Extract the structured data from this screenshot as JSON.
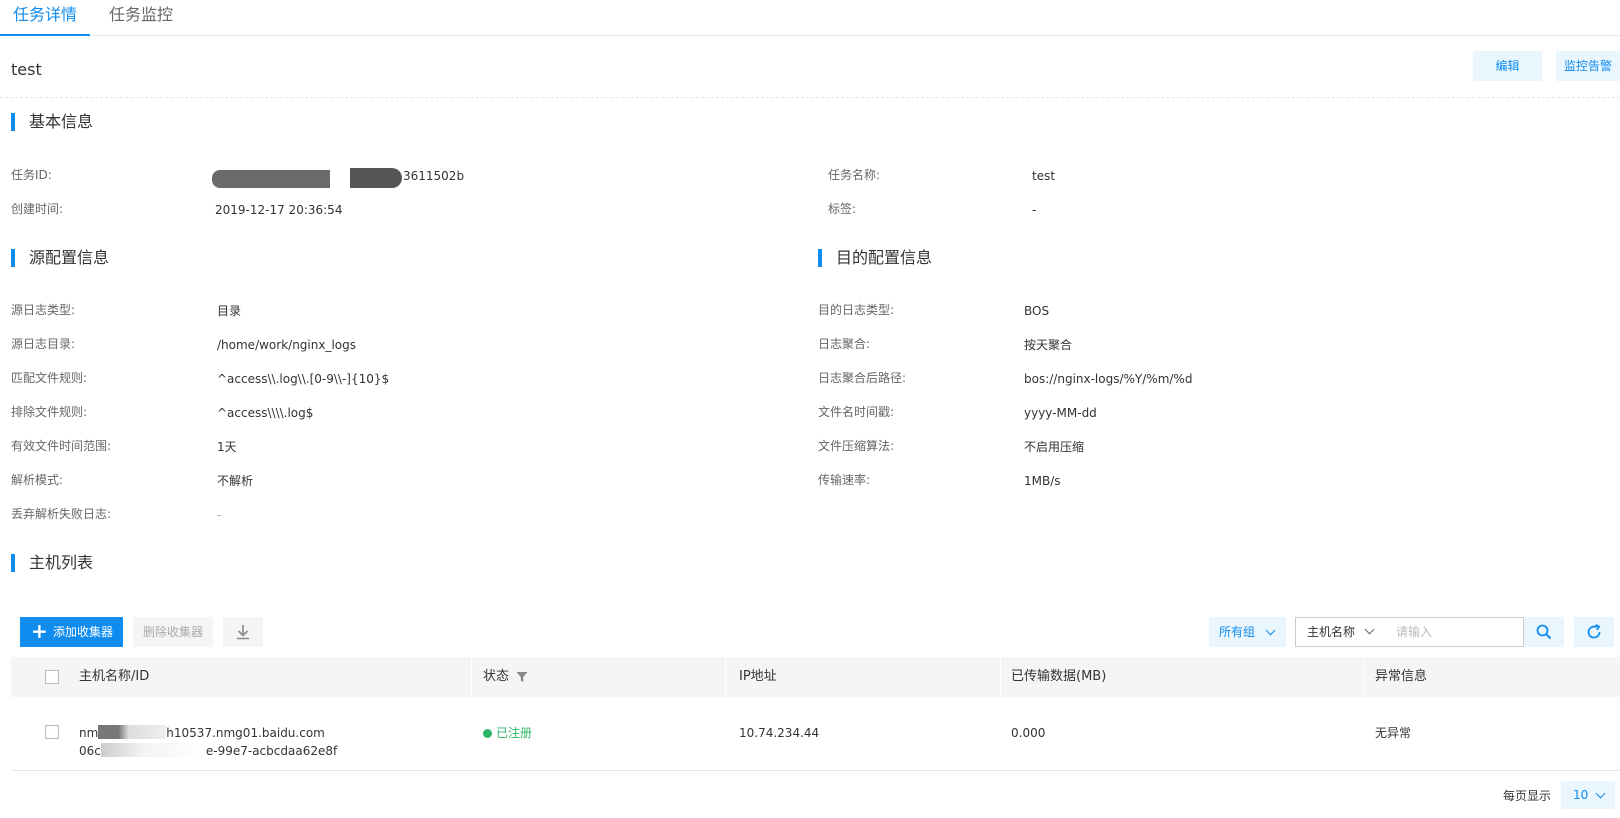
{
  "tabs": [
    {
      "label": "任务详情",
      "active": true
    },
    {
      "label": "任务监控",
      "active": false
    }
  ],
  "header": {
    "title": "test",
    "edit_label": "编辑",
    "alarm_label": "监控告警"
  },
  "basic": {
    "section_title": "基本信息",
    "task_id_label": "任务ID:",
    "task_id_value": "3611502b",
    "task_name_label": "任务名称:",
    "task_name_value": "test",
    "created_label": "创建时间:",
    "created_value": "2019-12-17 20:36:54",
    "tag_label": "标签:",
    "tag_value": "-"
  },
  "source": {
    "section_title": "源配置信息",
    "fields": [
      {
        "label": "源日志类型:",
        "value": "目录"
      },
      {
        "label": "源日志目录:",
        "value": "/home/work/nginx_logs"
      },
      {
        "label": "匹配文件规则:",
        "value": "^access\\\\.log\\\\.[0-9\\\\-]{10}$"
      },
      {
        "label": "排除文件规则:",
        "value": "^access\\\\\\\\.log$"
      },
      {
        "label": "有效文件时间范围:",
        "value": "1天"
      },
      {
        "label": "解析模式:",
        "value": "不解析"
      },
      {
        "label": "丢弃解析失败日志:",
        "value": "-"
      }
    ]
  },
  "dest": {
    "section_title": "目的配置信息",
    "fields": [
      {
        "label": "目的日志类型:",
        "value": "BOS"
      },
      {
        "label": "日志聚合:",
        "value": "按天聚合"
      },
      {
        "label": "日志聚合后路径:",
        "value": "bos://nginx-logs/%Y/%m/%d"
      },
      {
        "label": "文件名时间戳:",
        "value": "yyyy-MM-dd"
      },
      {
        "label": "文件压缩算法:",
        "value": "不启用压缩"
      },
      {
        "label": "传输速率:",
        "value": "1MB/s"
      }
    ]
  },
  "hosts": {
    "section_title": "主机列表",
    "add_label": "添加收集器",
    "delete_label": "删除收集器",
    "group_label": "所有组",
    "search_field": "主机名称",
    "search_placeholder": "请输入",
    "columns": [
      "主机名称/ID",
      "状态",
      "IP地址",
      "已传输数据(MB)",
      "异常信息"
    ],
    "rows": [
      {
        "name": "h10537.nmg01.baidu.com",
        "name_prefix": "nm",
        "id": "e-99e7-acbcdaa62e8f",
        "id_prefix": "06c",
        "status": "已注册",
        "ip": "10.74.234.44",
        "transferred": "0.000",
        "error": "无异常"
      }
    ],
    "page_size_label": "每页显示",
    "page_size": "10"
  },
  "colors": {
    "accent": "#108cee",
    "status_ok": "#2cb663"
  }
}
